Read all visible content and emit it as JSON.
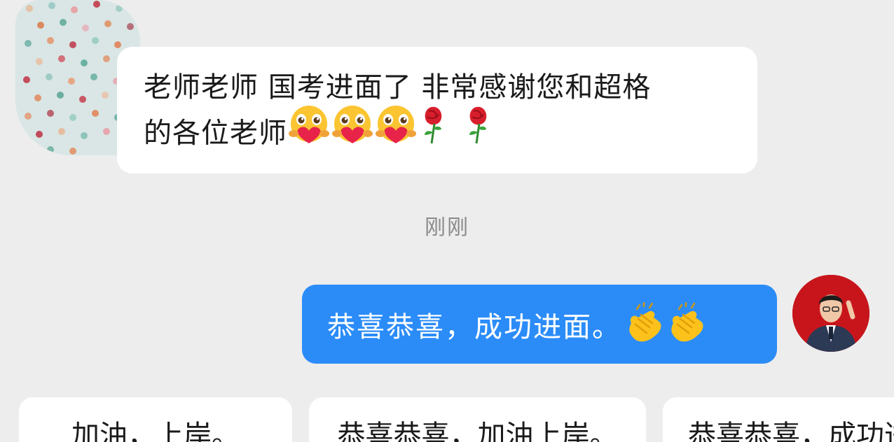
{
  "incoming_message": {
    "line1": "老师老师 国考进面了 非常感谢您和超格",
    "line2": "的各位老师",
    "emojis": [
      "hugging-face-with-heart",
      "hugging-face-with-heart",
      "hugging-face-with-heart",
      "rose",
      "rose"
    ]
  },
  "timestamp": "刚刚",
  "outgoing_message": {
    "text": "恭喜恭喜，成功进面。",
    "emojis": [
      "clapping-hands",
      "clapping-hands"
    ]
  },
  "quick_replies": [
    {
      "label": "加油，上岸。"
    },
    {
      "label": "恭喜恭喜，加油上岸。"
    },
    {
      "label": "恭喜恭喜，成功进"
    }
  ],
  "colors": {
    "background": "#ededed",
    "incoming_bubble": "#ffffff",
    "outgoing_bubble": "#2b8cf8",
    "timestamp_text": "#8a8a8a"
  }
}
